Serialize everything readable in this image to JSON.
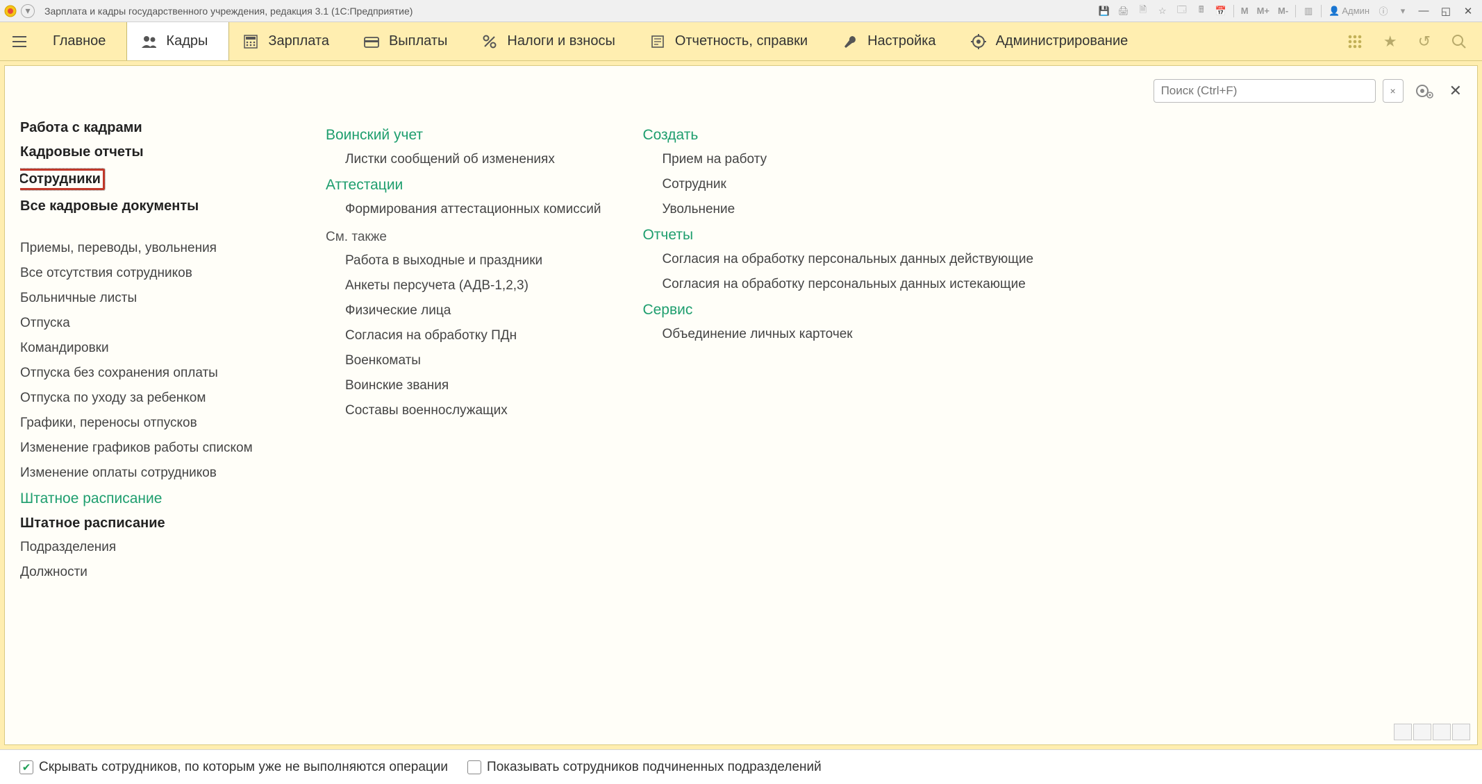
{
  "titlebar": {
    "title": "Зарплата и кадры государственного учреждения, редакция 3.1  (1С:Предприятие)",
    "m_labels": [
      "M",
      "M+",
      "M-"
    ],
    "admin_label": "Админ"
  },
  "nav": {
    "items": [
      {
        "label": "Главное",
        "icon": "menu"
      },
      {
        "label": "Кадры",
        "icon": "people",
        "active": true
      },
      {
        "label": "Зарплата",
        "icon": "calc"
      },
      {
        "label": "Выплаты",
        "icon": "wallet"
      },
      {
        "label": "Налоги и взносы",
        "icon": "percent"
      },
      {
        "label": "Отчетность, справки",
        "icon": "report"
      },
      {
        "label": "Настройка",
        "icon": "wrench"
      },
      {
        "label": "Администрирование",
        "icon": "gear"
      }
    ]
  },
  "search": {
    "placeholder": "Поиск (Ctrl+F)"
  },
  "col1": {
    "bold_links": [
      "Работа с кадрами",
      "Кадровые отчеты",
      "Сотрудники",
      "Все кадровые документы"
    ],
    "highlight_index": 2,
    "links_a": [
      "Приемы, переводы, увольнения",
      "Все отсутствия сотрудников",
      "Больничные листы",
      "Отпуска",
      "Командировки",
      "Отпуска без сохранения оплаты",
      "Отпуска по уходу за ребенком",
      "Графики, переносы отпусков",
      "Изменение графиков работы списком",
      "Изменение оплаты сотрудников"
    ],
    "group2": "Штатное расписание",
    "bold2": "Штатное расписание",
    "links_b": [
      "Подразделения",
      "Должности"
    ]
  },
  "col2": {
    "g1": "Воинский учет",
    "g1_links": [
      "Листки сообщений об изменениях"
    ],
    "g2": "Аттестации",
    "g2_links": [
      "Формирования аттестационных комиссий"
    ],
    "see_also": "См. также",
    "see_also_links": [
      "Работа в выходные и праздники",
      "Анкеты персучета (АДВ-1,2,3)",
      "Физические лица",
      "Согласия на обработку ПДн",
      "Военкоматы",
      "Воинские звания",
      "Составы военнослужащих"
    ]
  },
  "col3": {
    "g1": "Создать",
    "g1_links": [
      "Прием на работу",
      "Сотрудник",
      "Увольнение"
    ],
    "g2": "Отчеты",
    "g2_links": [
      "Согласия на обработку персональных данных действующие",
      "Согласия на обработку персональных данных истекающие"
    ],
    "g3": "Сервис",
    "g3_links": [
      "Объединение личных карточек"
    ]
  },
  "bottom": {
    "chk1": {
      "label": "Скрывать сотрудников, по которым уже не выполняются операции",
      "checked": true
    },
    "chk2": {
      "label": "Показывать сотрудников подчиненных подразделений",
      "checked": false
    }
  }
}
